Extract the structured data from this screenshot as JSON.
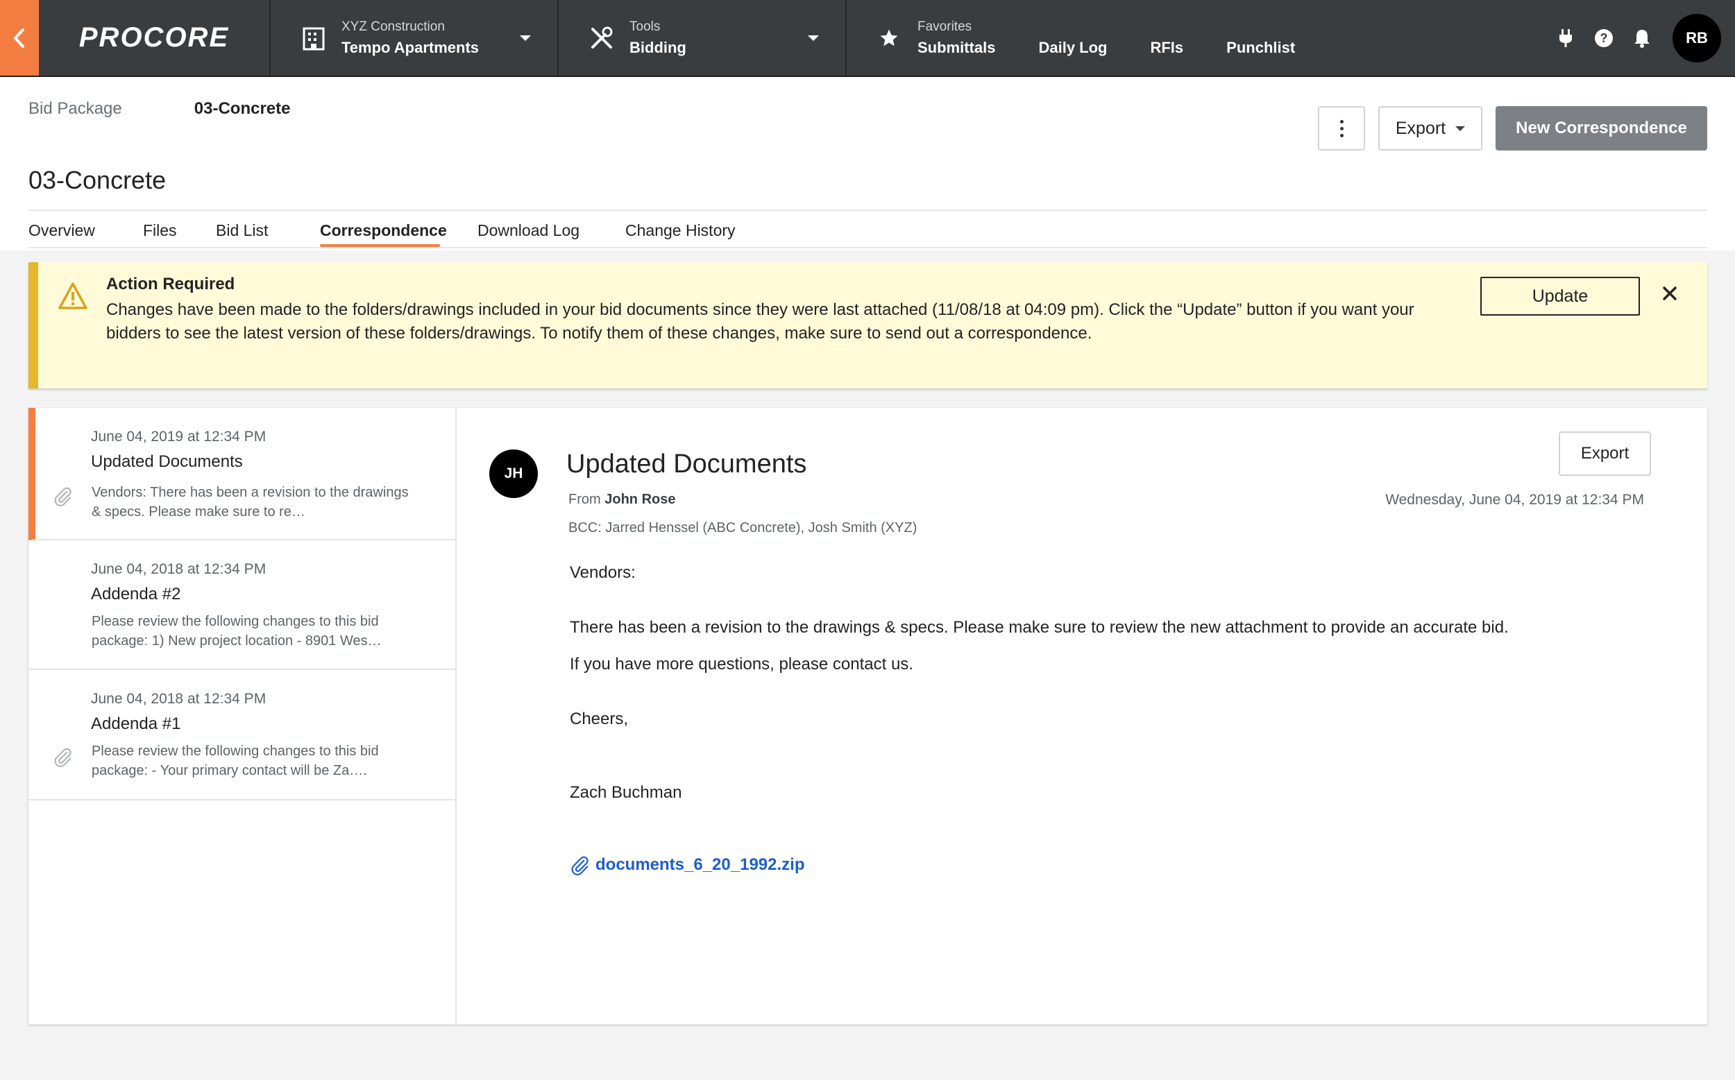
{
  "topbar": {
    "logo": "PROCORE",
    "project": {
      "small": "XYZ Construction",
      "big": "Tempo Apartments"
    },
    "tool": {
      "small": "Tools",
      "big": "Bidding"
    },
    "favorites": {
      "label": "Favorites",
      "links": [
        "Submittals",
        "Daily Log",
        "RFIs",
        "Punchlist"
      ]
    },
    "user_initials": "RB"
  },
  "breadcrumb": {
    "parent": "Bid Package",
    "current": "03-Concrete"
  },
  "page_title": "03-Concrete",
  "header_actions": {
    "export_label": "Export",
    "new_label": "New Correspondence"
  },
  "tabs": [
    "Overview",
    "Files",
    "Bid List",
    "Correspondence",
    "Download Log",
    "Change History"
  ],
  "active_tab": "Correspondence",
  "banner": {
    "title": "Action Required",
    "message": "Changes have been made to the folders/drawings included in your bid documents since they were last attached (11/08/18 at 04:09 pm). Click the “Update” button if you want your bidders to see the latest version of these folders/drawings. To notify them of these changes, make sure to send out a correspondence.",
    "update_label": "Update"
  },
  "correspondence": [
    {
      "date": "June 04, 2019 at 12:34 PM",
      "title": "Updated Documents",
      "snippet": "Vendors:  There has been a revision to the drawings & specs. Please make sure to re…",
      "has_attachment": true,
      "selected": true
    },
    {
      "date": "June 04, 2018 at 12:34 PM",
      "title": "Addenda #2",
      "snippet": "Please review the following changes to this bid package: 1) New project location - 8901 Wes…",
      "has_attachment": false,
      "selected": false
    },
    {
      "date": "June 04, 2018 at 12:34 PM",
      "title": "Addenda #1",
      "snippet": "Please review the following changes to this bid package: - Your primary contact will be Za….",
      "has_attachment": true,
      "selected": false
    }
  ],
  "detail": {
    "avatar": "JH",
    "subject": "Updated Documents",
    "from_prefix": "From",
    "from_name": "John Rose",
    "date": "Wednesday, June 04, 2019 at 12:34 PM",
    "bcc": "BCC: Jarred Henssel (ABC Concrete), Josh Smith (XYZ)",
    "export_label": "Export",
    "body": {
      "greeting": "Vendors:",
      "line1": "There has been a revision to the drawings & specs. Please make sure to review the new attachment to provide an accurate bid.",
      "line2": "If you have more questions, please contact us.",
      "signoff": "Cheers,",
      "signature": "Zach Buchman"
    },
    "attachment": "documents_6_20_1992.zip"
  },
  "colors": {
    "accent": "#f47e42",
    "nav": "#393d40",
    "banner_bg": "#fffbd9",
    "banner_border": "#e5b62e",
    "link": "#1d5fc8"
  }
}
